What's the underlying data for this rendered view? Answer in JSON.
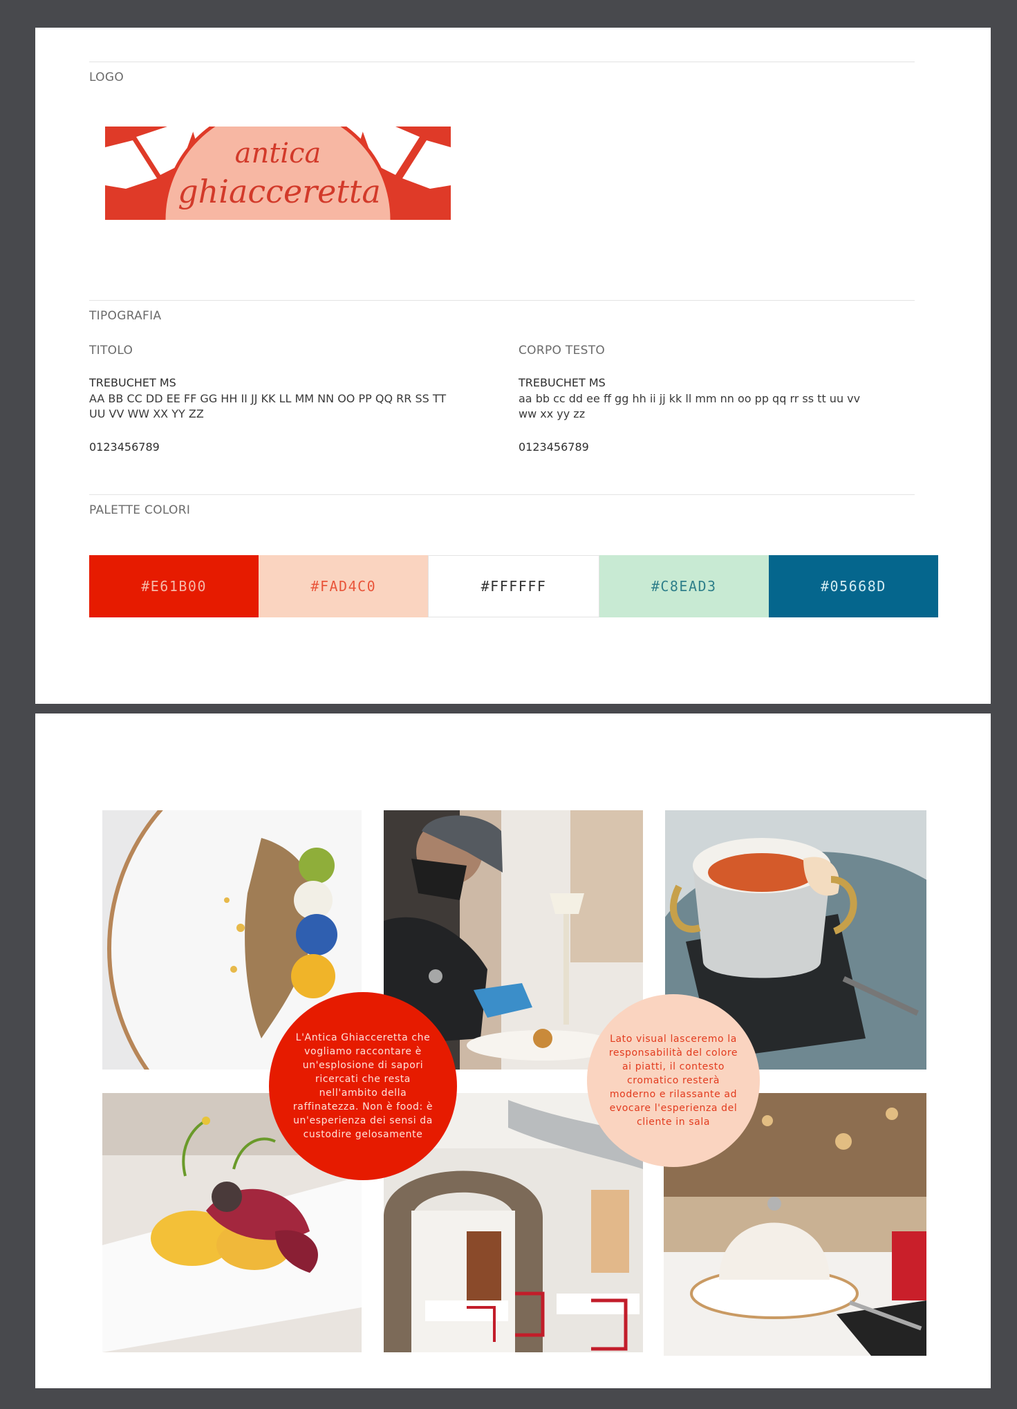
{
  "brand": {
    "logo_line1": "antica",
    "logo_line2": "ghiacceretta"
  },
  "sections": {
    "logo_label": "LOGO",
    "typography_label": "TIPOGRAFIA",
    "palette_label": "PALETTE COLORI"
  },
  "typography": {
    "title": {
      "label": "TITOLO",
      "font_name": "TREBUCHET MS",
      "sample_line1": "AA BB CC DD EE FF GG HH II JJ KK LL MM NN OO PP QQ RR SS TT",
      "sample_line2": "UU VV WW XX YY ZZ",
      "digits": "0123456789"
    },
    "body": {
      "label": "CORPO TESTO",
      "font_name": "TREBUCHET MS",
      "sample_line1": "aa bb cc dd ee ff gg hh ii jj kk ll mm nn oo pp qq rr ss tt uu vv",
      "sample_line2": "ww xx yy zz",
      "digits": "0123456789"
    }
  },
  "palette": [
    {
      "hex": "#E61B00",
      "text_color": "#f6b8a8"
    },
    {
      "hex": "#FAD4C0",
      "text_color": "#e9553a"
    },
    {
      "hex": "#FFFFFF",
      "text_color": "#333333"
    },
    {
      "hex": "#C8EAD3",
      "text_color": "#2f7f8a"
    },
    {
      "hex": "#05668D",
      "text_color": "#d3ecf2"
    }
  ],
  "moodboard": {
    "bubble_left": "L'Antica Ghiacceretta che vogliamo raccontare è un'esplosione di sapori ricercati che resta nell'ambito della raffinatezza. Non è food: è un'esperienza dei sensi da custodire gelosamente",
    "bubble_right": "Lato visual lasceremo la responsabilità del colore ai piatti, il contesto cromatico resterà moderno e rilassante ad evocare l'esperienza del cliente in sala",
    "photos": [
      {
        "subject": "plate-pasta-vegetables-photo"
      },
      {
        "subject": "chef-plating-photo"
      },
      {
        "subject": "soup-pot-photo"
      },
      {
        "subject": "dessert-plate-photo"
      },
      {
        "subject": "dining-room-arch-photo"
      },
      {
        "subject": "cloche-bowl-photo"
      }
    ]
  }
}
